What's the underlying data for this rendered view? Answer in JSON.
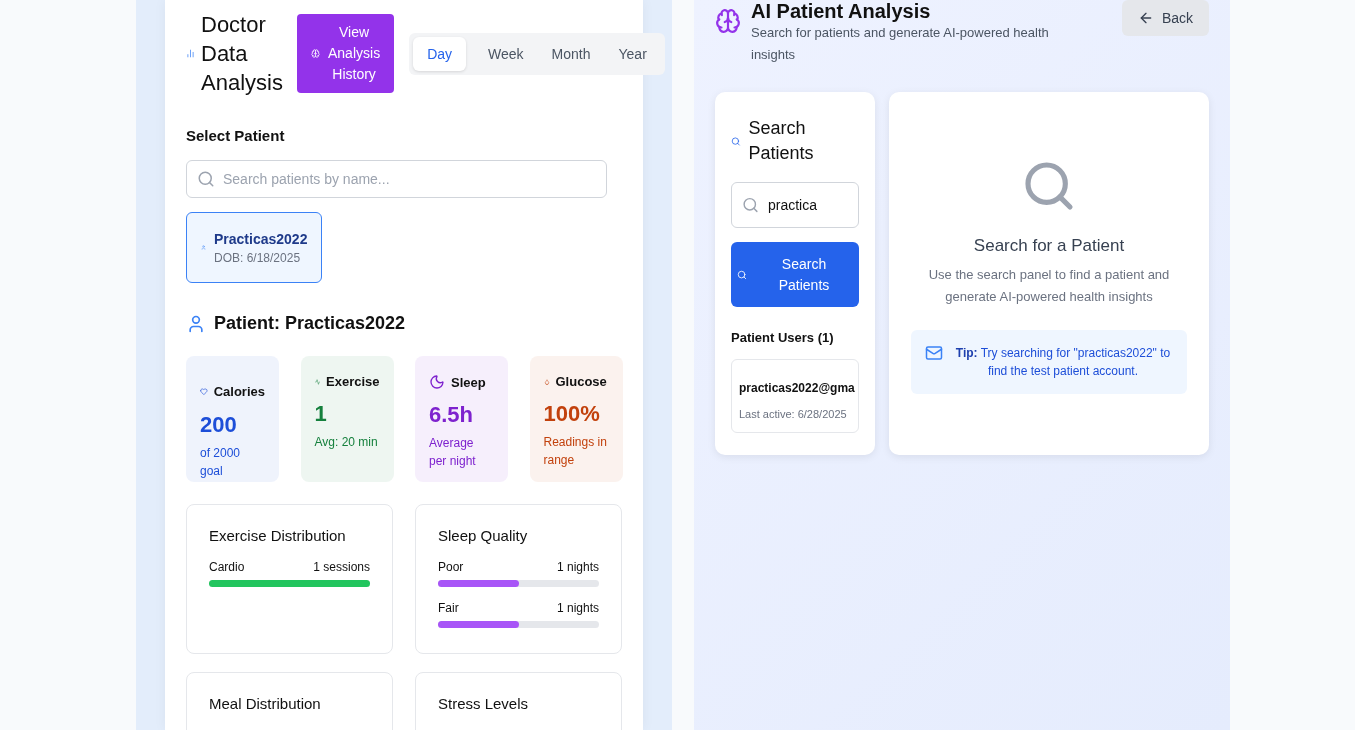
{
  "dashboard": {
    "title": "Doctor Data Analysis",
    "history_button": "View Analysis History",
    "periods": [
      {
        "label": "Day",
        "selected": true
      },
      {
        "label": "Week",
        "selected": false
      },
      {
        "label": "Month",
        "selected": false
      },
      {
        "label": "Year",
        "selected": false
      }
    ],
    "select_label": "Select Patient",
    "search": {
      "placeholder": "Search patients by name..."
    },
    "patients": [
      {
        "name": "Practicas2022",
        "dob": "DOB: 6/18/2025",
        "selected": true
      }
    ],
    "patient_heading": "Patient: Practicas2022",
    "stats": [
      {
        "kind": "calories",
        "label": "Calories",
        "value": "200",
        "note": "of 2000 goal",
        "color": "#1d4ed8"
      },
      {
        "kind": "exercise",
        "label": "Exercise",
        "value": "1",
        "note": "Avg: 20 min",
        "color": "#15803d"
      },
      {
        "kind": "sleep",
        "label": "Sleep",
        "value": "6.5h",
        "note": "Average per night",
        "color": "#7e22ce"
      },
      {
        "kind": "glucose",
        "label": "Glucose",
        "value": "100%",
        "note": "Readings in range",
        "color": "#c2410c"
      }
    ],
    "charts": [
      {
        "title": "Exercise Distribution",
        "rows": [
          {
            "label": "Cardio",
            "reading": "1 sessions",
            "level": 1,
            "color": "#22c55e"
          }
        ]
      },
      {
        "title": "Sleep Quality",
        "rows": [
          {
            "label": "Poor",
            "reading": "1 nights",
            "level": 0.5,
            "color": "#a855f7"
          },
          {
            "label": "Fair",
            "reading": "1 nights",
            "level": 0.5,
            "color": "#a855f7"
          }
        ]
      },
      {
        "title": "Meal Distribution"
      },
      {
        "title": "Stress Levels"
      }
    ]
  },
  "ai": {
    "title": "AI Patient Analysis",
    "subtitle": "Search for patients and generate AI-powered health insights",
    "back": "Back",
    "search_title": "Search Patients",
    "search_value": "practica",
    "search_button": "Search Patients",
    "users_heading": "Patient Users (1)",
    "users": [
      {
        "email": "practicas2022@gma",
        "last_active": "Last active: 6/28/2025"
      }
    ],
    "empty_title": "Search for a Patient",
    "empty_text": "Use the search panel to find a patient and generate AI-powered health insights",
    "tip": "**Tip:** Try searching for \"practicas2022\" to find the test patient account."
  }
}
